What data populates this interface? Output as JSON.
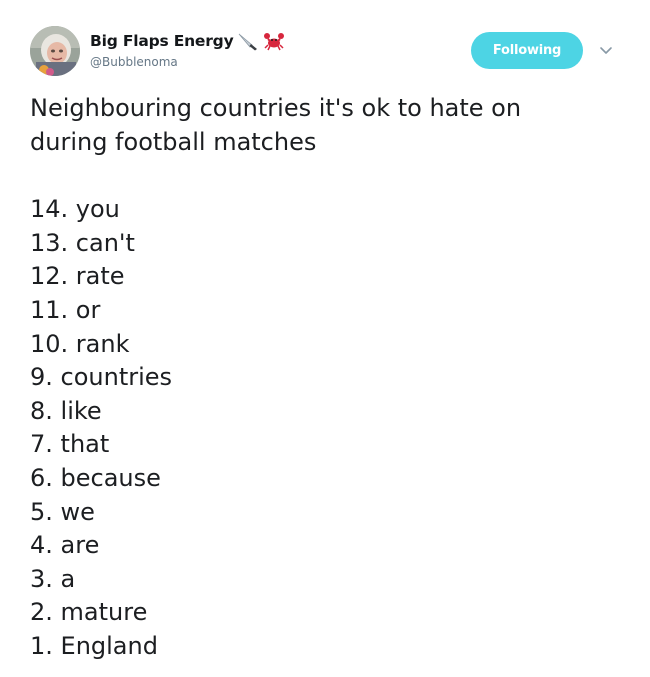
{
  "user": {
    "display_name": "Big Flaps Energy",
    "handle": "@Bubblenoma",
    "name_emojis": [
      "knife-icon",
      "crab-icon"
    ]
  },
  "follow_button": {
    "label": "Following",
    "color": "#4dd4e4"
  },
  "tweet": {
    "intro_lines": [
      "Neighbouring countries it's ok to hate on",
      "during football matches"
    ],
    "list": [
      "14. you",
      "13. can't",
      "12. rate",
      "11. or",
      "10. rank",
      "9. countries",
      "8. like",
      "7. that",
      "6. because",
      "5. we",
      "4. are",
      "3. a",
      "2. mature",
      "1. England"
    ]
  }
}
